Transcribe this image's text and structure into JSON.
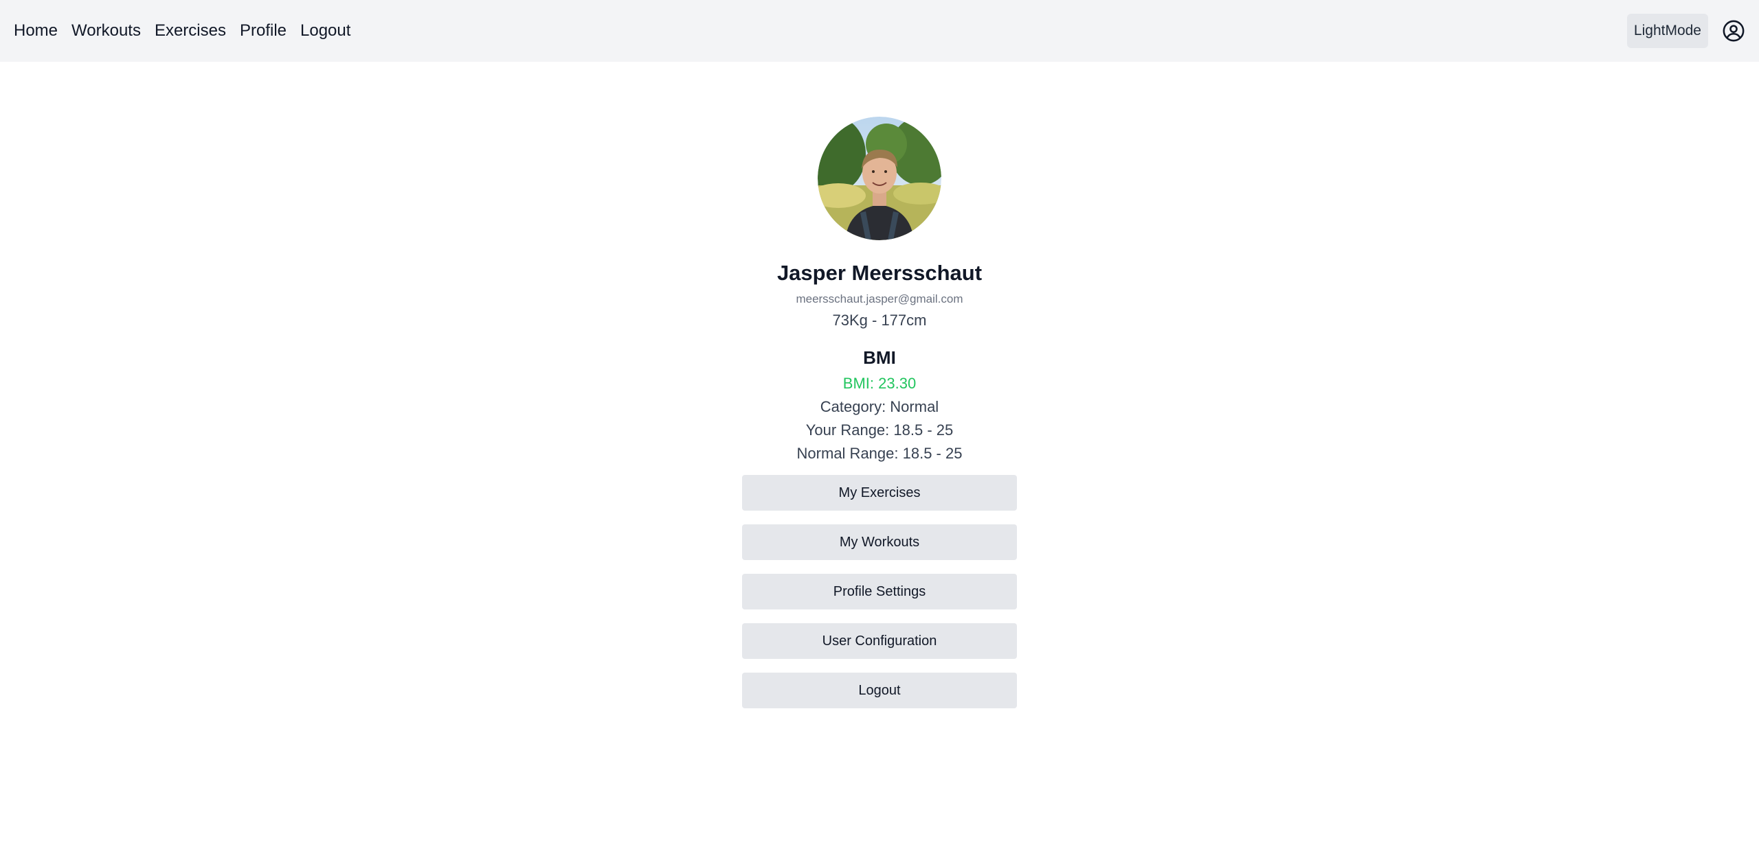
{
  "nav": {
    "links": [
      "Home",
      "Workouts",
      "Exercises",
      "Profile",
      "Logout"
    ],
    "mode_label": "LightMode",
    "account_icon": "user-circle-icon"
  },
  "profile": {
    "avatar_description": "profile-photo",
    "name": "Jasper Meersschaut",
    "email": "meersschaut.jasper@gmail.com",
    "stats": "73Kg - 177cm"
  },
  "bmi": {
    "title": "BMI",
    "value": "BMI: 23.30",
    "category": "Category: Normal",
    "your_range": "Your Range: 18.5 - 25",
    "normal_range": "Normal Range: 18.5 - 25"
  },
  "actions": {
    "my_exercises": "My Exercises",
    "my_workouts": "My Workouts",
    "profile_settings": "Profile Settings",
    "user_configuration": "User Configuration",
    "logout": "Logout"
  },
  "colors": {
    "navbar_bg": "#f3f4f6",
    "button_bg": "#e5e7eb",
    "bmi_green": "#22c55e",
    "muted_text": "#6b7280"
  }
}
